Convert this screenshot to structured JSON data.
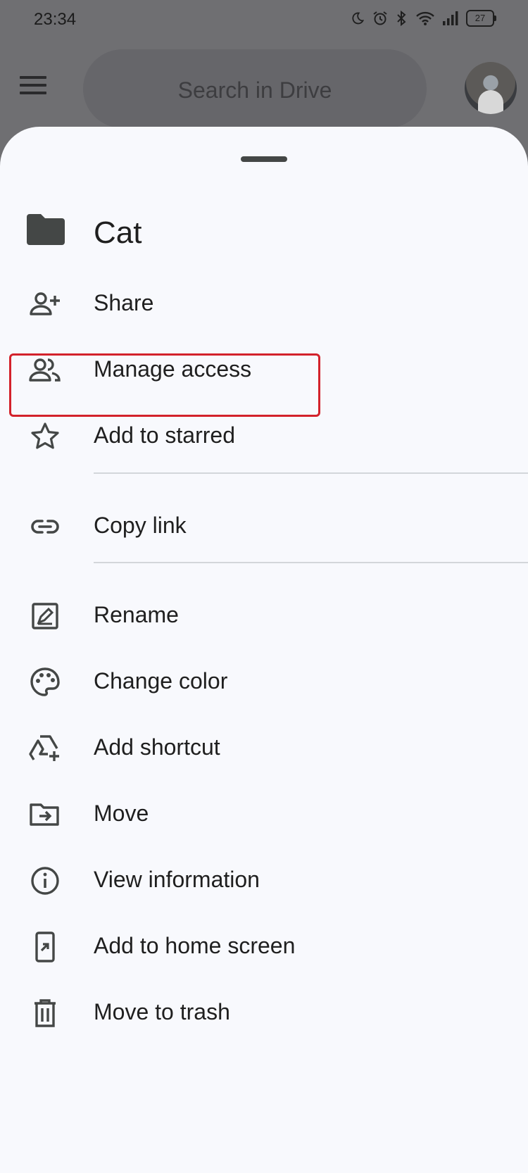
{
  "status_bar": {
    "time": "23:34",
    "battery": "27",
    "icons": [
      "moon-icon",
      "alarm-icon",
      "bluetooth-icon",
      "wifi-icon",
      "signal-icon",
      "battery-icon"
    ]
  },
  "top_bar": {
    "search_placeholder": "Search in Drive"
  },
  "sheet": {
    "title": "Cat",
    "items": [
      {
        "label": "Share",
        "icon": "person-add-icon"
      },
      {
        "label": "Manage access",
        "icon": "people-icon"
      },
      {
        "label": "Add to starred",
        "icon": "star-icon"
      },
      {
        "label": "Copy link",
        "icon": "link-icon"
      },
      {
        "label": "Rename",
        "icon": "edit-icon"
      },
      {
        "label": "Change color",
        "icon": "palette-icon"
      },
      {
        "label": "Add shortcut",
        "icon": "add-shortcut-icon"
      },
      {
        "label": "Move",
        "icon": "move-folder-icon"
      },
      {
        "label": "View information",
        "icon": "info-icon"
      },
      {
        "label": "Add to home screen",
        "icon": "add-to-home-icon"
      },
      {
        "label": "Move to trash",
        "icon": "trash-icon"
      }
    ]
  },
  "colors": {
    "highlight": "#d3222b",
    "sheet_bg": "#f8f9fd",
    "scrim": "#6f6f72"
  }
}
